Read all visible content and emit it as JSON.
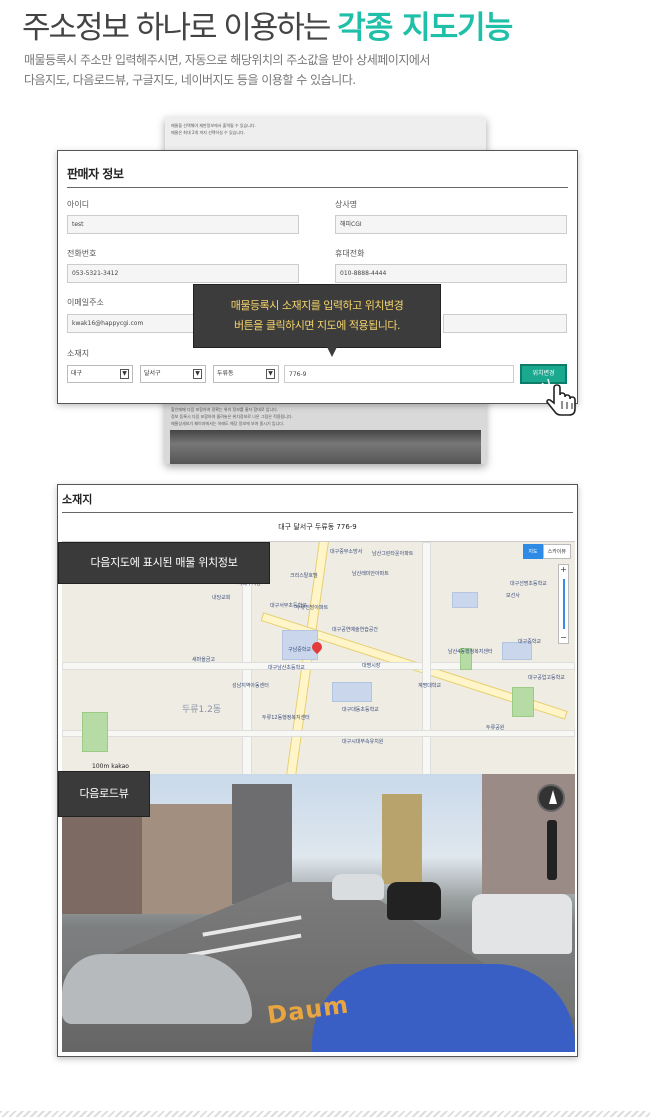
{
  "hero": {
    "title_plain": "주소정보 하나로 이용하는",
    "title_accent": "각종 지도기능",
    "desc_line1": "매물등록시 주소만 입력해주시면, 자동으로 해당위치의 주소값을 받아 상세페이지에서",
    "desc_line2": "다음지도, 다음로드뷰, 구글지도, 네이버지도 등을 이용할 수 있습니다."
  },
  "bg_page": {
    "line1": "매물을 선택해야 재판정보에서 출력될 수 있습니다.",
    "line2": "매물은 최대 2개 까지 선택하실 수 있습니다.",
    "line3": "할인매매 다음 포함하여 정확는 위치 정보를 줄자 함대로 입니다.",
    "line4": "정보 등록시 다음 포함하여 올려놓은 위치정보로 나온 그림은 적용됩니다.",
    "line5": "매물상세보기 페이지에서는 아래도 해당 정보에 보여 중시기 입니다."
  },
  "form": {
    "title": "판매자 정보",
    "id_label": "아이디",
    "id_value": "test",
    "company_label": "상사명",
    "company_value": "해피CGI",
    "phone_label": "전화번호",
    "phone_value": "053-5321-3412",
    "mobile_label": "휴대전화",
    "mobile_value": "010-8888-4444",
    "email_label": "이메일주소",
    "email_value": "kwak16@happycgi.com",
    "location_label": "소재지",
    "city": "대구",
    "district": "달서구",
    "dong": "두류동",
    "address_detail": "776-9",
    "change_button": "위치변경",
    "select_arrow": "▼"
  },
  "tooltip": {
    "line1": "매물등록시 소재지를 입력하고 위치변경",
    "line2": "버튼을 클릭하시면 지도에 적용됩니다."
  },
  "location": {
    "title": "소재지",
    "address": "대구 달서구 두류동 776-9",
    "map_tag": "다음지도에 표시된 매물 위치정보",
    "roadview_tag": "다음로드뷰",
    "map_type_map": "지도",
    "map_type_sky": "스카이뷰",
    "zoom_in": "+",
    "zoom_out": "−",
    "scale": "100m",
    "scale_brand": "kakao",
    "map_labels": {
      "m1": "남산그린타운아파트",
      "m2": "남산래미안아파트",
      "m3": "대구중부소방서",
      "m4": "크리스탈호텔",
      "m5": "내당교회",
      "m6": "서대구시장",
      "m7": "대구서부초등학교",
      "m8": "두류진방아파트",
      "m9": "구남중학교",
      "m10": "대구남산초등학교",
      "m11": "새마을금고",
      "m12": "성남지역아동센터",
      "m13": "두류1.2동",
      "m14": "두류12동행정복지센터",
      "m15": "대구대동초등학교",
      "m16": "대구시대부속유치원",
      "m17": "대구공연예술연습공간",
      "m18": "대명시장",
      "m19": "남산4동행정복지센터",
      "m20": "대구중학교",
      "m21": "계명대학교",
      "m22": "대구공업고등학교",
      "m23": "두류공원",
      "m24": "보선사",
      "m25": "대구선명초등학교"
    },
    "roadview_logo": "Daum"
  },
  "colors": {
    "accent": "#1fbfa8",
    "tooltip_text": "#f5d46a",
    "button": "#1aa98f",
    "tag_bg": "#3a3a3a"
  }
}
